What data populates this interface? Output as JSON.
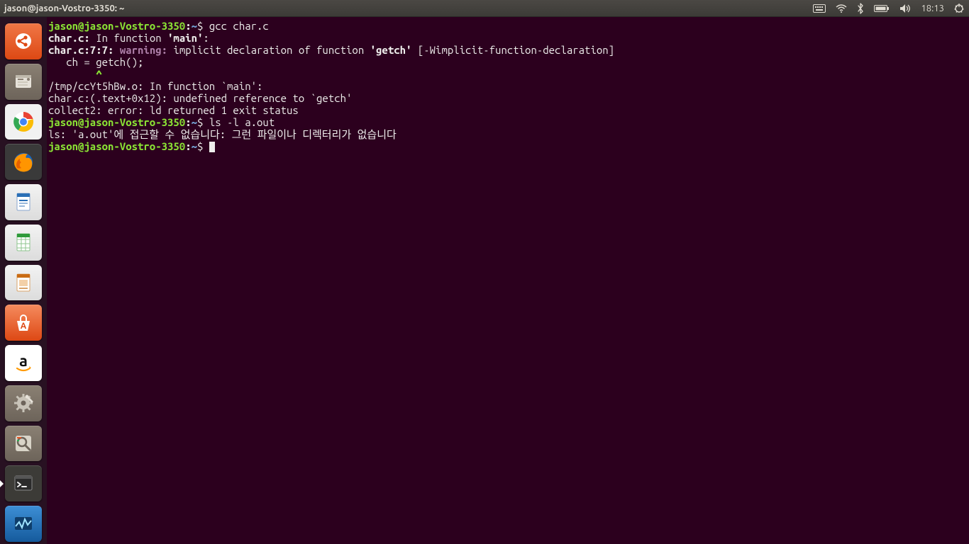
{
  "panel": {
    "title": "jason@jason-Vostro-3350: ~",
    "clock": "18:13"
  },
  "launcher_items": [
    {
      "name": "dash",
      "color": "#dd4814"
    },
    {
      "name": "files",
      "color": "#7a7064"
    },
    {
      "name": "chrome",
      "color": "#f5f5f5"
    },
    {
      "name": "firefox",
      "color": "#2e2e2e"
    },
    {
      "name": "writer",
      "color": "#e8e8e8"
    },
    {
      "name": "calc",
      "color": "#e8e8e8"
    },
    {
      "name": "impress",
      "color": "#e8e8e8"
    },
    {
      "name": "software-center",
      "color": "#e95420"
    },
    {
      "name": "amazon",
      "color": "#ffffff"
    },
    {
      "name": "settings",
      "color": "#7a7064"
    },
    {
      "name": "system-monitor-lens",
      "color": "#7a7064"
    },
    {
      "name": "terminal",
      "color": "#3a3a3a",
      "running": true
    },
    {
      "name": "system-monitor",
      "color": "#2b6fb3"
    }
  ],
  "terminal": {
    "prompt_user": "jason@jason-Vostro-3350",
    "prompt_sep": ":",
    "prompt_path": "~",
    "prompt_dollar": "$ ",
    "cmd1": "gcc char.c",
    "l1a": "char.c:",
    "l1b": " In function ",
    "l1c": "'main'",
    "l1d": ":",
    "l2a": "char.c:7:7: ",
    "l2b": "warning: ",
    "l2c": "implicit declaration of function ",
    "l2d": "'getch'",
    "l2e": " [-Wimplicit-function-declaration]",
    "l3": "   ch = getch();",
    "l4a": "        ",
    "l4b": "^",
    "l5": "/tmp/ccYt5hBw.o: In function `main':",
    "l6": "char.c:(.text+0x12): undefined reference to `getch'",
    "l7": "collect2: error: ld returned 1 exit status",
    "cmd2": "ls -l a.out",
    "l8": "ls: 'a.out'에 접근할 수 없습니다: 그런 파일이나 디렉터리가 없습니다"
  }
}
